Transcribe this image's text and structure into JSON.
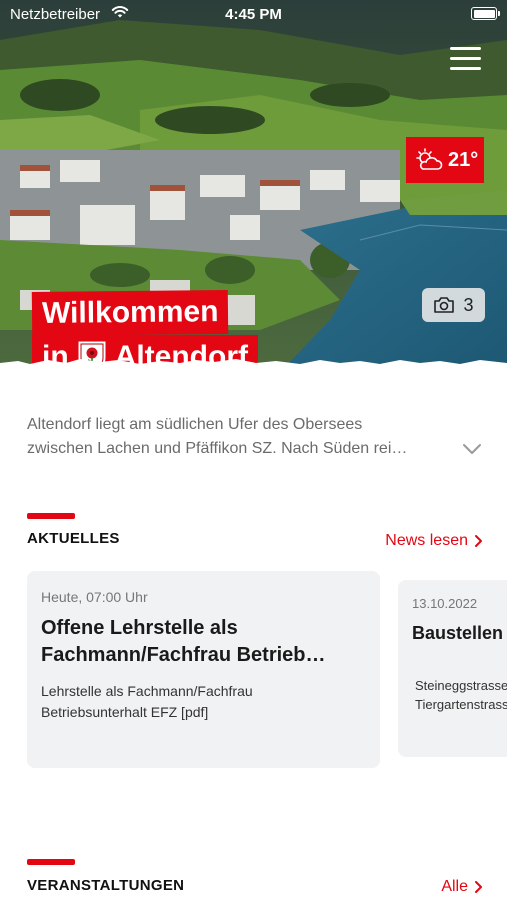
{
  "status_bar": {
    "carrier": "Netzbetreiber",
    "time": "4:45 PM"
  },
  "hero": {
    "title_line1": "Willkommen",
    "title_line2_prefix": "in",
    "title_line2_name": "Altendorf",
    "weather": {
      "temperature": "21°",
      "icon": "partly-cloudy-icon"
    },
    "photo_count": "3"
  },
  "intro": {
    "line1": "Altendorf liegt am südlichen Ufer des Obersees",
    "line2": "zwischen Lachen und Pfäffikon SZ. Nach Süden rei…"
  },
  "news": {
    "section_title": "AKTUELLES",
    "link_label": "News lesen",
    "items": [
      {
        "date": "Heute, 07:00 Uhr",
        "title_line1": "Offene Lehrstelle als",
        "title_line2": "Fachmann/Fachfrau Betrieb…",
        "body_line1": "Lehrstelle als Fachmann/Fachfrau",
        "body_line2": "Betriebsunterhalt EFZ [pdf]"
      },
      {
        "date": "13.10.2022",
        "title_line1": "Baustellen",
        "body_line1": "Steineggstrasse",
        "body_line2": "Tiergartenstrasse"
      }
    ]
  },
  "events": {
    "section_title": "VERANSTALTUNGEN",
    "link_label": "Alle"
  },
  "colors": {
    "accent": "#e30613",
    "card_bg": "#f0f2f3",
    "muted_text": "#6b6b6b"
  }
}
